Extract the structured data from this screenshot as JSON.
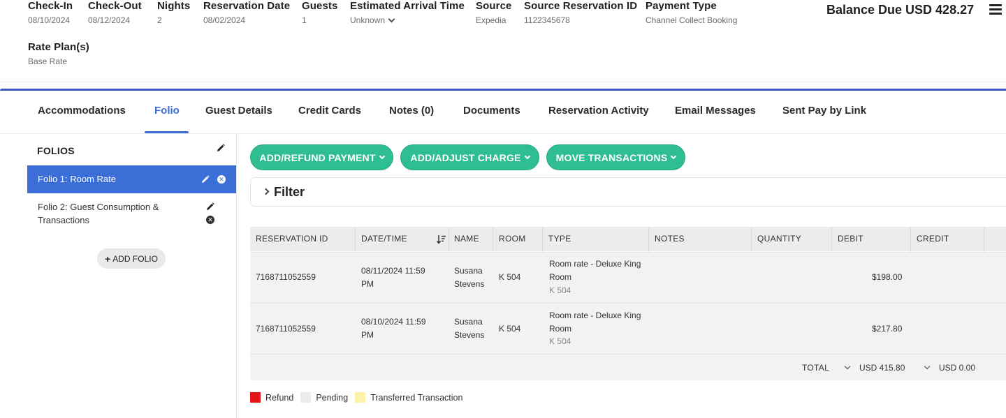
{
  "summary": {
    "check_in": {
      "label": "Check-In",
      "value": "08/10/2024"
    },
    "check_out": {
      "label": "Check-Out",
      "value": "08/12/2024"
    },
    "nights": {
      "label": "Nights",
      "value": "2"
    },
    "reservation_date": {
      "label": "Reservation Date",
      "value": "08/02/2024"
    },
    "guests": {
      "label": "Guests",
      "value": "1"
    },
    "arrival_time": {
      "label": "Estimated Arrival Time",
      "value": "Unknown"
    },
    "source": {
      "label": "Source",
      "value": "Expedia"
    },
    "source_reservation_id": {
      "label": "Source Reservation ID",
      "value": "1122345678"
    },
    "payment_type": {
      "label": "Payment Type",
      "value": "Channel Collect Booking"
    },
    "rate_plans": {
      "label": "Rate Plan(s)",
      "value": "Base Rate"
    },
    "balance_due": "Balance Due USD 428.27"
  },
  "tabs": [
    {
      "label": "Accommodations"
    },
    {
      "label": "Folio"
    },
    {
      "label": "Guest Details"
    },
    {
      "label": "Credit Cards"
    },
    {
      "label": "Notes (0)"
    },
    {
      "label": "Documents"
    },
    {
      "label": "Reservation Activity"
    },
    {
      "label": "Email Messages"
    },
    {
      "label": "Sent Pay by Link"
    }
  ],
  "folios": {
    "title": "FOLIOS",
    "items": [
      {
        "label": "Folio 1: Room Rate"
      },
      {
        "label": "Folio 2: Guest Consumption & Transactions"
      }
    ],
    "add_label": "ADD FOLIO"
  },
  "actions": {
    "add_refund_payment": "ADD/REFUND PAYMENT",
    "add_adjust_charge": "ADD/ADJUST CHARGE",
    "move_transactions": "MOVE TRANSACTIONS"
  },
  "filter": {
    "label": "Filter"
  },
  "table": {
    "columns": [
      "RESERVATION ID",
      "DATE/TIME",
      "NAME",
      "ROOM",
      "TYPE",
      "NOTES",
      "QUANTITY",
      "DEBIT",
      "CREDIT"
    ],
    "rows": [
      {
        "reservation_id": "7168711052559",
        "date_line1": "08/11/2024 11:59",
        "date_line2": "PM",
        "name_line1": "Susana",
        "name_line2": "Stevens",
        "room": "K 504",
        "type_line1": "Room rate - Deluxe King",
        "type_line2": "Room",
        "type_sub": "K 504",
        "debit": "$198.00"
      },
      {
        "reservation_id": "7168711052559",
        "date_line1": "08/10/2024 11:59",
        "date_line2": "PM",
        "name_line1": "Susana",
        "name_line2": "Stevens",
        "room": "K 504",
        "type_line1": "Room rate - Deluxe King",
        "type_line2": "Room",
        "type_sub": "K 504",
        "debit": "$217.80"
      }
    ],
    "total": {
      "label": "TOTAL",
      "debit": "USD 415.80",
      "credit": "USD 0.00"
    }
  },
  "legend": [
    {
      "label": "Refund",
      "color": "#e8141b"
    },
    {
      "label": "Pending",
      "color": "#ececec"
    },
    {
      "label": "Transferred Transaction",
      "color": "#fdf3a8"
    }
  ]
}
